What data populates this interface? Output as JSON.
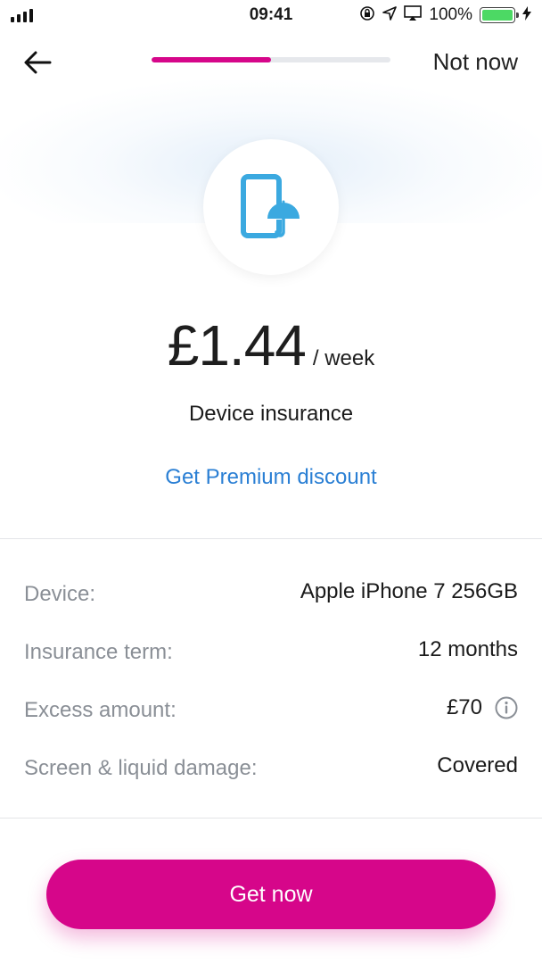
{
  "status_bar": {
    "time": "09:41",
    "battery_percent": "100%",
    "icons": [
      "signal-icon",
      "orientation-lock-icon",
      "location-icon",
      "airplay-icon",
      "battery-icon",
      "charging-icon"
    ]
  },
  "header": {
    "back_icon": "back-arrow-icon",
    "progress_fraction": 0.5,
    "dismiss_label": "Not now"
  },
  "hero": {
    "icon": "phone-umbrella-icon",
    "price": "£1.44",
    "period": "/ week",
    "product": "Device insurance",
    "discount_link": "Get Premium discount"
  },
  "details": [
    {
      "label": "Device:",
      "value": "Apple iPhone 7 256GB",
      "has_info": false
    },
    {
      "label": "Insurance term:",
      "value": "12 months",
      "has_info": false
    },
    {
      "label": "Excess amount:",
      "value": "£70",
      "has_info": true
    },
    {
      "label": "Screen & liquid damage:",
      "value": "Covered",
      "has_info": false
    }
  ],
  "cta": {
    "label": "Get now"
  },
  "colors": {
    "accent": "#d6068a",
    "link": "#2a7fd4",
    "icon": "#3ba9e0",
    "label_grey": "#8a8f96",
    "battery_green": "#4cd964"
  }
}
